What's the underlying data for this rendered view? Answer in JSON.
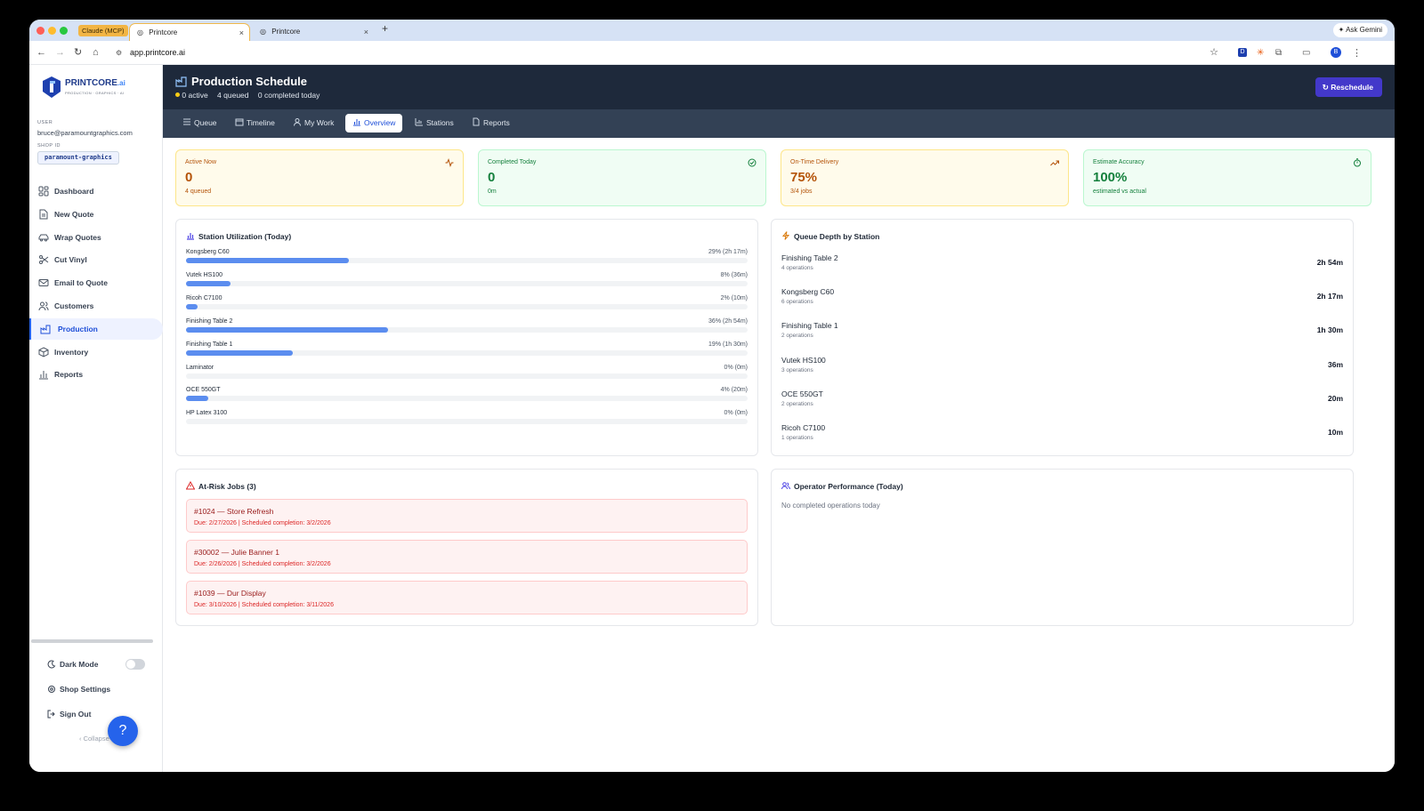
{
  "browser": {
    "pinned_tab": "Claude (MCP)",
    "tabs": [
      {
        "title": "Printcore"
      },
      {
        "title": "Printcore"
      }
    ],
    "url": "app.printcore.ai",
    "ask_gemini": "Ask Gemini",
    "profile_initial": "B"
  },
  "sidebar": {
    "logo_text": "PRINTCORE",
    "logo_suffix": ".ai",
    "logo_tagline": "PRODUCTION · GRAPHICS · AI",
    "user_label": "USER",
    "user_email": "bruce@paramountgraphics.com",
    "shop_label": "SHOP ID",
    "shop_id": "paramount-graphics",
    "items": [
      {
        "label": "Dashboard",
        "icon": "dashboard-icon"
      },
      {
        "label": "New Quote",
        "icon": "document-icon"
      },
      {
        "label": "Wrap Quotes",
        "icon": "car-icon"
      },
      {
        "label": "Cut Vinyl",
        "icon": "scissors-icon"
      },
      {
        "label": "Email to Quote",
        "icon": "mail-icon"
      },
      {
        "label": "Customers",
        "icon": "users-icon"
      },
      {
        "label": "Production",
        "icon": "factory-icon",
        "active": true
      },
      {
        "label": "Inventory",
        "icon": "box-icon"
      },
      {
        "label": "Reports",
        "icon": "bar-chart-icon"
      }
    ],
    "dark_mode": "Dark Mode",
    "dark_mode_on": false,
    "shop_settings": "Shop Settings",
    "sign_out": "Sign Out",
    "collapse": "Collapse"
  },
  "header": {
    "title": "Production Schedule",
    "active": "0 active",
    "queued": "4 queued",
    "completed": "0 completed today",
    "reschedule": "Reschedule"
  },
  "subnav": [
    "Queue",
    "Timeline",
    "My Work",
    "Overview",
    "Stations",
    "Reports"
  ],
  "subnav_active": "Overview",
  "kpis": [
    {
      "title": "Active Now",
      "value": "0",
      "sub": "4 queued",
      "bg": "#fffbeb",
      "border": "#fde68a",
      "color": "#b45309"
    },
    {
      "title": "Completed Today",
      "value": "0",
      "sub": "0m",
      "bg": "#f0fdf4",
      "border": "#bbf7d0",
      "color": "#15803d"
    },
    {
      "title": "On-Time Delivery",
      "value": "75%",
      "sub": "3/4 jobs",
      "bg": "#fffbeb",
      "border": "#fde68a",
      "color": "#b45309"
    },
    {
      "title": "Estimate Accuracy",
      "value": "100%",
      "sub": "estimated vs actual",
      "bg": "#f0fdf4",
      "border": "#bbf7d0",
      "color": "#15803d"
    }
  ],
  "utilization": {
    "title": "Station Utilization (Today)",
    "rows": [
      {
        "name": "Kongsberg C60",
        "pct_label": "29% (2h 17m)",
        "pct": 29
      },
      {
        "name": "Vutek HS100",
        "pct_label": "8% (36m)",
        "pct": 8
      },
      {
        "name": "Ricoh C7100",
        "pct_label": "2% (10m)",
        "pct": 2
      },
      {
        "name": "Finishing Table 2",
        "pct_label": "36% (2h 54m)",
        "pct": 36
      },
      {
        "name": "Finishing Table 1",
        "pct_label": "19% (1h 30m)",
        "pct": 19
      },
      {
        "name": "Laminator",
        "pct_label": "0% (0m)",
        "pct": 0
      },
      {
        "name": "OCE 550GT",
        "pct_label": "4% (20m)",
        "pct": 4
      },
      {
        "name": "HP Latex 3100",
        "pct_label": "0% (0m)",
        "pct": 0
      }
    ]
  },
  "queue": {
    "title": "Queue Depth by Station",
    "rows": [
      {
        "name": "Finishing Table 2",
        "ops": "4 operations",
        "dur": "2h 54m"
      },
      {
        "name": "Kongsberg C60",
        "ops": "6 operations",
        "dur": "2h 17m"
      },
      {
        "name": "Finishing Table 1",
        "ops": "2 operations",
        "dur": "1h 30m"
      },
      {
        "name": "Vutek HS100",
        "ops": "3 operations",
        "dur": "36m"
      },
      {
        "name": "OCE 550GT",
        "ops": "2 operations",
        "dur": "20m"
      },
      {
        "name": "Ricoh C7100",
        "ops": "1 operations",
        "dur": "10m"
      }
    ]
  },
  "risk": {
    "title": "At-Risk Jobs (3)",
    "jobs": [
      {
        "title": "#1024 — Store Refresh",
        "detail": "Due: 2/27/2026 | Scheduled completion: 3/2/2026"
      },
      {
        "title": "#30002 — Julie Banner 1",
        "detail": "Due: 2/26/2026 | Scheduled completion: 3/2/2026"
      },
      {
        "title": "#1039 — Dur Display",
        "detail": "Due: 3/10/2026 | Scheduled completion: 3/11/2026"
      }
    ]
  },
  "operators": {
    "title": "Operator Performance (Today)",
    "empty": "No completed operations today"
  },
  "colors": {
    "accent": "#2563eb",
    "header_bg": "#1e293b",
    "subnav_bg": "#334155",
    "reschedule": "#4338ca"
  }
}
